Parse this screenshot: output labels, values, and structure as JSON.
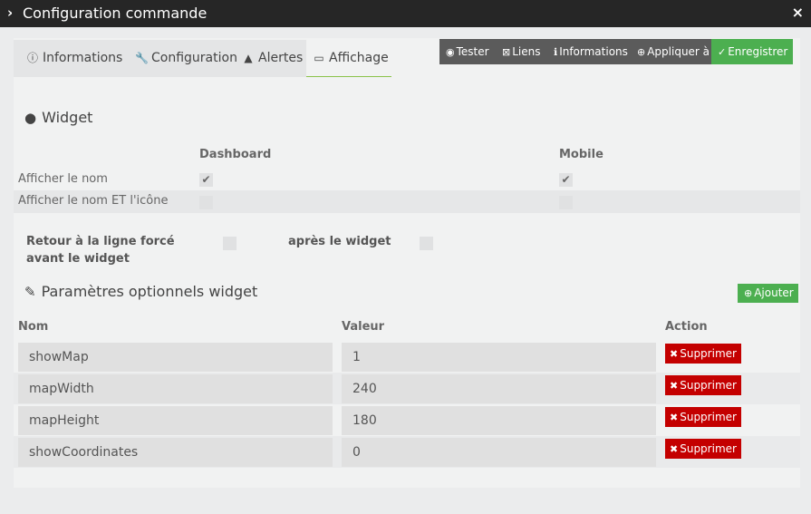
{
  "window": {
    "title": "Configuration commande",
    "close_icon": "×"
  },
  "tabs": [
    {
      "label": "Informations",
      "icon": "info-circle-icon",
      "active": false
    },
    {
      "label": "Configuration",
      "icon": "wrench-icon",
      "active": false
    },
    {
      "label": "Alertes",
      "icon": "warning-icon",
      "active": false
    },
    {
      "label": "Affichage",
      "icon": "desktop-icon",
      "active": true
    }
  ],
  "toolbar": {
    "tester_label": "Tester",
    "liens_label": "Liens",
    "informations_label": "Informations",
    "appliquer_label": "Appliquer à",
    "enregistrer_label": "Enregistrer"
  },
  "widget": {
    "title": "Widget",
    "col_dashboard": "Dashboard",
    "col_mobile": "Mobile",
    "rows": [
      {
        "label": "Afficher le nom",
        "dashboard": true,
        "mobile": true
      },
      {
        "label": "Afficher le nom ET l'icône",
        "dashboard": false,
        "mobile": false
      }
    ],
    "linebreak_before_label": "Retour à la ligne forcé avant le widget",
    "linebreak_after_label": "après le widget",
    "linebreak_before": false,
    "linebreak_after": false
  },
  "params": {
    "title": "Paramètres optionnels widget",
    "add_label": "Ajouter",
    "col_nom": "Nom",
    "col_valeur": "Valeur",
    "col_action": "Action",
    "delete_label": "Supprimer",
    "rows": [
      {
        "name": "showMap",
        "value": "1"
      },
      {
        "name": "mapWidth",
        "value": "240"
      },
      {
        "name": "mapHeight",
        "value": "180"
      },
      {
        "name": "showCoordinates",
        "value": "0"
      }
    ]
  },
  "colors": {
    "titlebar": "#262626",
    "dark_button": "#5b5b5b",
    "green": "#4caf50",
    "red": "#c40000",
    "active_tab_underline": "#8bc34a"
  }
}
